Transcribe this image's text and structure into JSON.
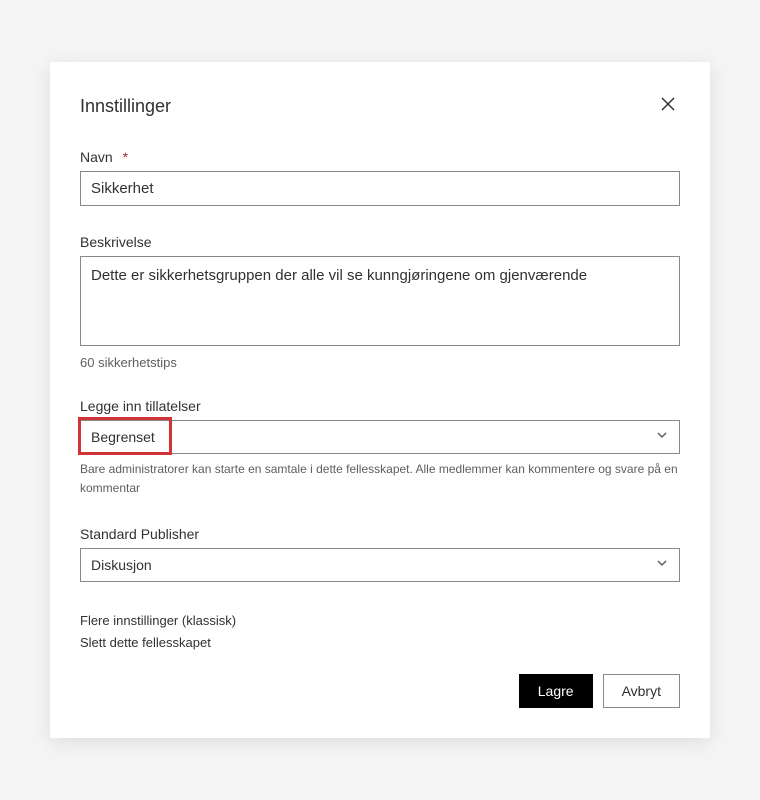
{
  "dialog": {
    "title": "Innstillinger"
  },
  "name": {
    "label": "Navn",
    "value": "Sikkerhet"
  },
  "description": {
    "label": "Beskrivelse",
    "value": "Dette er sikkerhetsgruppen der alle vil se kunngjøringene om gjenværende",
    "count": "60",
    "count_suffix": "sikkerhetstips"
  },
  "permissions": {
    "label": "Legge inn tillatelser",
    "selected": "Begrenset",
    "help": "Bare administratorer kan starte en samtale i dette fellesskapet. Alle medlemmer kan kommentere og svare på en kommentar"
  },
  "publisher": {
    "label": "Standard Publisher",
    "selected": "Diskusjon"
  },
  "links": {
    "more_settings": "Flere innstillinger (klassisk)",
    "delete_community": "Slett dette fellesskapet"
  },
  "buttons": {
    "save": "Lagre",
    "cancel": "Avbryt"
  }
}
